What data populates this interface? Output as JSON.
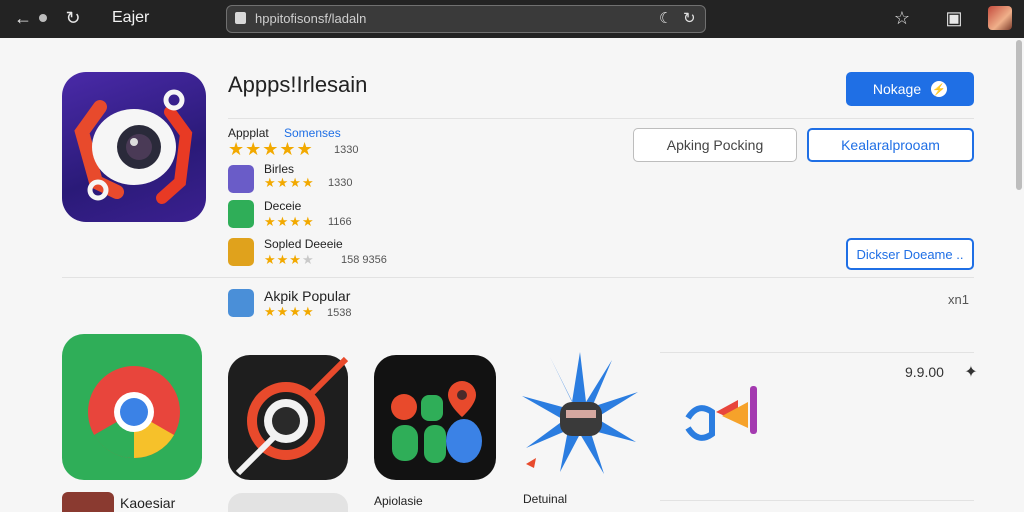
{
  "browser": {
    "title": "Eajer",
    "url": "hppitofisonsf/ladaln",
    "icons": [
      "back-icon",
      "forward-icon",
      "reload-icon",
      "star-icon",
      "share-icon"
    ]
  },
  "hero": {
    "title": "Appps!Irlesain",
    "meta_label": "Appplat",
    "meta_link": "Somenses",
    "rating_count": "1330"
  },
  "reviews": [
    {
      "name": "Birles",
      "rating_count": "1330"
    },
    {
      "name": "Deceie",
      "rating_count": "1166"
    },
    {
      "name": "Sopled Deeeie",
      "rating_count": "158 9356"
    }
  ],
  "featured": {
    "name": "Akpik Popular",
    "rating_count": "1538",
    "extra": "xn1"
  },
  "buttons": {
    "primary": "Nokage",
    "secondary": "Apking Pocking",
    "outline": "Kealaralprooam",
    "details": "Dickser Doeame .."
  },
  "grid": {
    "price": "9.9.00",
    "captions": [
      "Kaoesiar",
      "Apiolasie",
      "Detuinal"
    ]
  },
  "colors": {
    "accent": "#1f6fe5",
    "star": "#f2a900"
  }
}
